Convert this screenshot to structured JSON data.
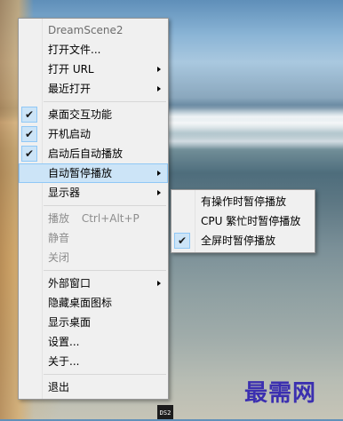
{
  "menu": {
    "header": "DreamScene2",
    "items": [
      {
        "label": "打开文件..."
      },
      {
        "label": "打开 URL"
      },
      {
        "label": "最近打开"
      },
      {
        "label": "桌面交互功能"
      },
      {
        "label": "开机启动"
      },
      {
        "label": "启动后自动播放"
      },
      {
        "label": "自动暂停播放"
      },
      {
        "label": "显示器"
      },
      {
        "label": "播放",
        "shortcut": "Ctrl+Alt+P"
      },
      {
        "label": "静音"
      },
      {
        "label": "关闭"
      },
      {
        "label": "外部窗口"
      },
      {
        "label": "隐藏桌面图标"
      },
      {
        "label": "显示桌面"
      },
      {
        "label": "设置..."
      },
      {
        "label": "关于..."
      },
      {
        "label": "退出"
      }
    ]
  },
  "submenu": {
    "items": [
      {
        "label": "有操作时暂停播放"
      },
      {
        "label": "CPU 繁忙时暂停播放"
      },
      {
        "label": "全屏时暂停播放"
      }
    ]
  },
  "check_glyph": "✔",
  "watermark": "最需网",
  "taskbar_icon": "DS2"
}
